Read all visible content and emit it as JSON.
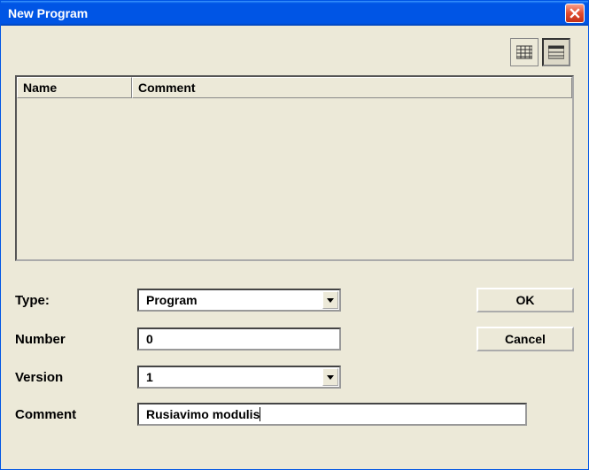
{
  "window": {
    "title": "New Program"
  },
  "list": {
    "columns": {
      "name": "Name",
      "comment": "Comment"
    },
    "rows": []
  },
  "form": {
    "type_label": "Type:",
    "type_value": "Program",
    "number_label": "Number",
    "number_value": "0",
    "version_label": "Version",
    "version_value": "1",
    "comment_label": "Comment",
    "comment_value": "Rusiavimo modulis"
  },
  "buttons": {
    "ok": "OK",
    "cancel": "Cancel"
  }
}
